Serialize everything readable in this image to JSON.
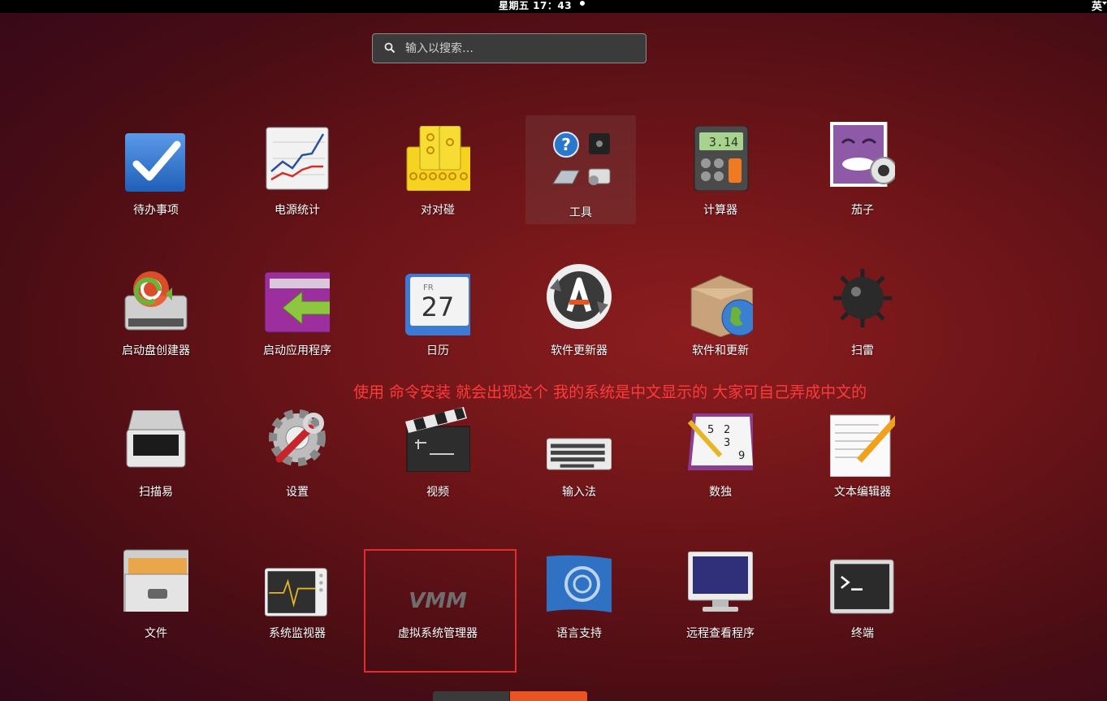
{
  "topbar": {
    "clock": "星期五 17：43",
    "input_method": "英"
  },
  "search": {
    "placeholder": "输入以搜索…"
  },
  "apps": {
    "todo": "待办事项",
    "power": "电源统计",
    "mahjongg": "对对碰",
    "tools": "工具",
    "calculator": "计算器",
    "cheese": "茄子",
    "usb_creator": "启动盘创建器",
    "startup": "启动应用程序",
    "calendar": "日历",
    "updater": "软件更新器",
    "software_updates": "软件和更新",
    "mines": "扫雷",
    "scanner": "扫描易",
    "settings": "设置",
    "videos": "视频",
    "input_method": "输入法",
    "sudoku": "数独",
    "text_editor": "文本编辑器",
    "files": "文件",
    "system_monitor": "系统监视器",
    "virt_manager": "虚拟系统管理器",
    "language_support": "语言支持",
    "remote_viewer": "远程查看程序",
    "terminal": "终端"
  },
  "icon_text": {
    "calculator_display": "3.14",
    "calendar_day": "FR",
    "calendar_date": "27",
    "virt_manager_logo": "VMM",
    "sudoku_digits": [
      "5",
      "2",
      "3",
      "9"
    ]
  },
  "annotation": "使用  命令安装  就会出现这个  我的系统是中文显示的  大家可自己弄成中文的",
  "colors": {
    "accent": "#e95420",
    "annotation": "#ff3a3a",
    "highlight_box": "#e02e2e"
  }
}
